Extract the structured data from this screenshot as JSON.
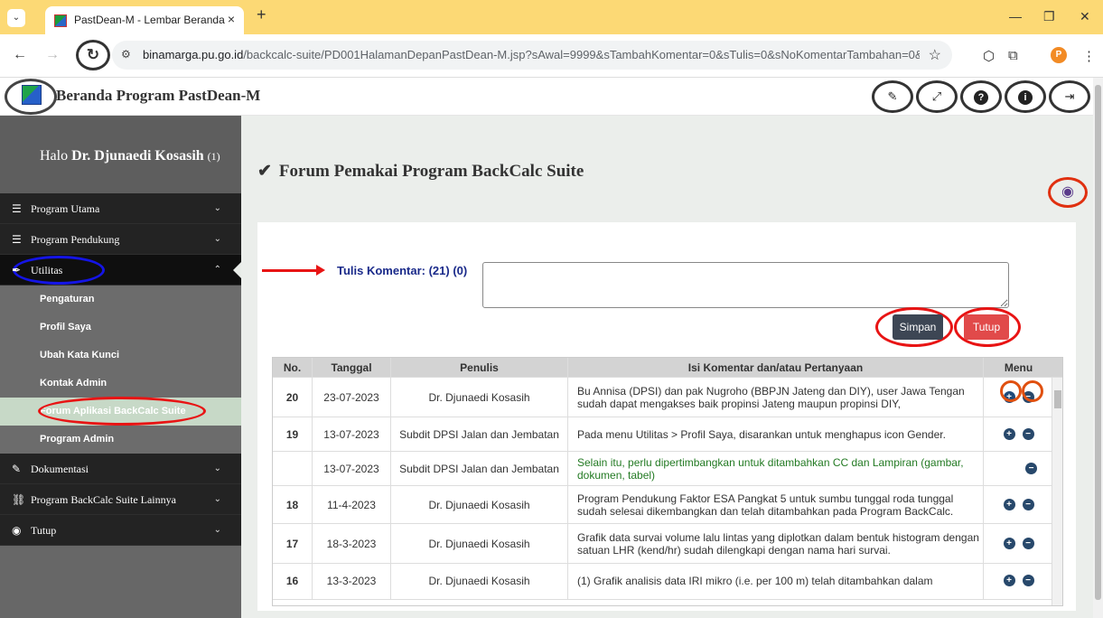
{
  "browser": {
    "tab_title": "PastDean-M - Lembar Beranda",
    "tab_close": "×",
    "new_tab": "+",
    "url_domain": "binamarga.pu.go.id",
    "url_path": "/backcalc-suite/PD001HalamanDepanPastDean-M.jsp?sAwal=9999&sTambahKomentar=0&sTulis=0&sNoKomentarTambahan=0&sTampila...",
    "profile_initial": "P"
  },
  "header": {
    "title": "Beranda Program PastDean-M"
  },
  "sidebar": {
    "greeting_prefix": "Halo",
    "user_name": "Dr. Djunaedi Kosasih",
    "user_count": "(1)",
    "menu": [
      {
        "label": "Program Utama"
      },
      {
        "label": "Program Pendukung"
      },
      {
        "label": "Utilitas"
      },
      {
        "label": "Dokumentasi"
      },
      {
        "label": "Program BackCalc Suite Lainnya"
      },
      {
        "label": "Tutup"
      }
    ],
    "submenu": [
      {
        "label": "Pengaturan"
      },
      {
        "label": "Profil Saya"
      },
      {
        "label": "Ubah Kata Kunci"
      },
      {
        "label": "Kontak Admin"
      },
      {
        "label": "Forum Aplikasi BackCalc Suite"
      },
      {
        "label": "Program Admin"
      }
    ]
  },
  "main": {
    "title": "Forum Pemakai Program BackCalc Suite",
    "tulis_label": "Tulis Komentar: (21) (0)",
    "save_label": "Simpan",
    "close_label": "Tutup",
    "table": {
      "headers": [
        "No.",
        "Tanggal",
        "Penulis",
        "Isi Komentar dan/atau Pertanyaan",
        "Menu"
      ],
      "rows": [
        {
          "no": "20",
          "date": "23-07-2023",
          "author": "Dr. Djunaedi Kosasih",
          "text": "Bu Annisa (DPSI) dan pak Nugroho (BBPJN Jateng dan DIY), user Jawa Tengan sudah dapat mengakses baik propinsi Jateng maupun propinsi DIY,"
        },
        {
          "no": "19",
          "date": "13-07-2023",
          "author": "Subdit DPSI Jalan dan Jembatan",
          "text": "Pada menu Utilitas > Profil Saya, disarankan untuk menghapus icon Gender."
        },
        {
          "no": "",
          "date": "13-07-2023",
          "author": "Subdit DPSI Jalan dan Jembatan",
          "text": "Selain itu, perlu dipertimbangkan untuk ditambahkan CC dan Lampiran (gambar, dokumen, tabel)"
        },
        {
          "no": "18",
          "date": "11-4-2023",
          "author": "Dr. Djunaedi Kosasih",
          "text": "Program Pendukung Faktor ESA Pangkat 5 untuk sumbu tunggal roda tunggal sudah selesai dikembangkan dan telah ditambahkan pada Program BackCalc."
        },
        {
          "no": "17",
          "date": "18-3-2023",
          "author": "Dr. Djunaedi Kosasih",
          "text": "Grafik data survai volume lalu lintas yang diplotkan dalam bentuk histogram dengan satuan LHR (kend/hr) sudah dilengkapi dengan nama hari survai."
        },
        {
          "no": "16",
          "date": "13-3-2023",
          "author": "Dr. Djunaedi Kosasih",
          "text": "(1) Grafik analisis data IRI mikro (i.e. per 100 m) telah ditambahkan dalam"
        }
      ]
    }
  }
}
